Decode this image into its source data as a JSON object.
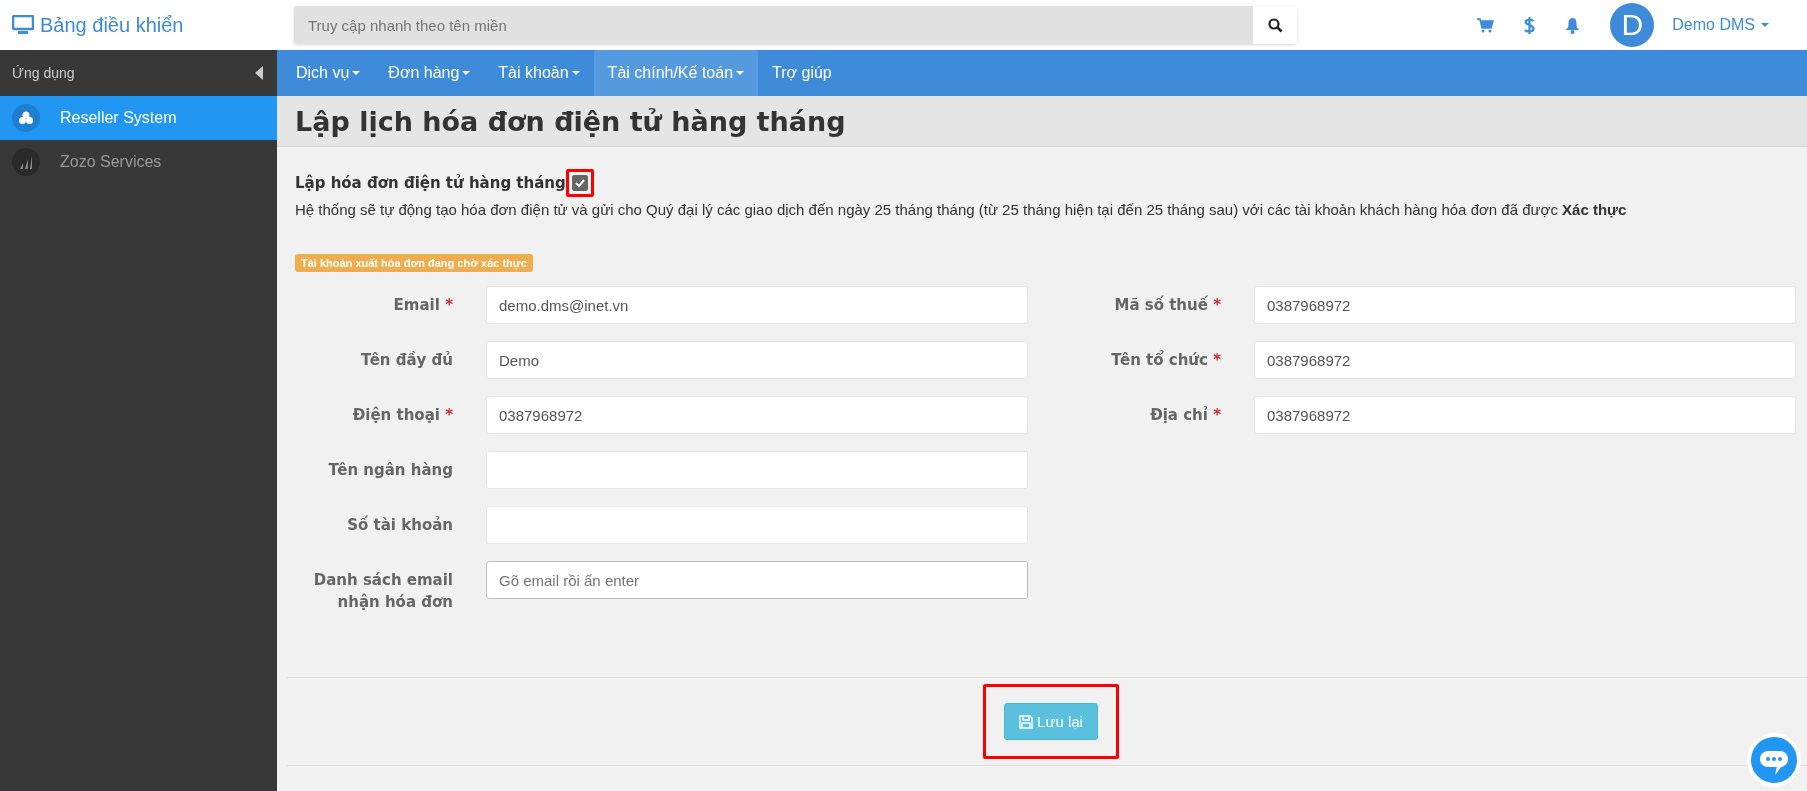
{
  "header": {
    "brand": "Bảng điều khiển",
    "search": {
      "placeholder": "Truy cập nhanh theo tên miền"
    },
    "avatar_letter": "D",
    "user": "Demo DMS"
  },
  "sidebar": {
    "title": "Ứng dụng",
    "items": [
      {
        "label": "Reseller System",
        "selected": true
      },
      {
        "label": "Zozo Services",
        "selected": false
      }
    ]
  },
  "nav": [
    {
      "label": "Dịch vụ",
      "dropdown": true,
      "selected": false
    },
    {
      "label": "Đơn hàng",
      "dropdown": true,
      "selected": false
    },
    {
      "label": "Tài khoản",
      "dropdown": true,
      "selected": false
    },
    {
      "label": "Tài chính/Kế toán",
      "dropdown": true,
      "selected": true
    },
    {
      "label": "Trợ giúp",
      "dropdown": false,
      "selected": false
    }
  ],
  "page_title": "Lập lịch hóa đơn điện tử hàng tháng",
  "schedule": {
    "label": "Lập hóa đơn điện tử hàng tháng",
    "checked": true,
    "highlighted": true,
    "description": "Hệ thống sẽ tự động tạo hóa đơn điện tử và gửi cho Quý đại lý các giao dịch đến ngày 25 tháng tháng (từ 25 tháng hiện tại đến 25 tháng sau) với các tài khoản khách hàng hóa đơn đã được **Xác thực**"
  },
  "status_badge": "Tài khoản xuất hóa đơn đang chờ xác thực",
  "form_left": [
    {
      "label": "Email",
      "required_mark": "*",
      "value": "demo.dms@inet.vn"
    },
    {
      "label": "Tên đầy đủ",
      "value": "Demo"
    },
    {
      "label": "Điện thoại",
      "required_mark": "*",
      "value": "0387968972"
    },
    {
      "label": "Tên ngân hàng"
    },
    {
      "label": "Số tài khoản"
    },
    {
      "label": "Danh sách email nhận hóa đơn",
      "placeholder": "Gõ email rồi ấn enter"
    }
  ],
  "form_right": [
    {
      "label": "Mã số thuế",
      "required_mark": "*",
      "value": "0387968972"
    },
    {
      "label": "Tên tổ chức",
      "required_mark": "*",
      "value": "0387968972"
    },
    {
      "label": "Địa chỉ",
      "required_mark": "*",
      "value": "0387968972"
    }
  ],
  "save_button": {
    "label": "Lưu lại",
    "highlighted": true
  }
}
